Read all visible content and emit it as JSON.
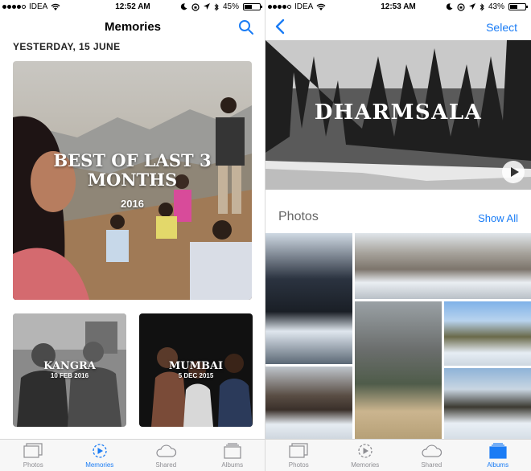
{
  "left_screen": {
    "status": {
      "carrier": "IDEA",
      "time": "12:52 AM",
      "battery": "45%",
      "battery_level": 0.45
    },
    "nav": {
      "title": "Memories"
    },
    "section_date": "YESTERDAY, 15 JUNE",
    "memories": [
      {
        "title_line1": "BEST OF LAST 3",
        "title_line2": "MONTHS",
        "subtitle": "2016"
      },
      {
        "title": "KANGRA",
        "subtitle": "10 FEB 2016"
      },
      {
        "title": "MUMBAI",
        "subtitle": "5 DEC 2015"
      }
    ],
    "tabs": [
      {
        "label": "Photos",
        "icon": "photos-icon"
      },
      {
        "label": "Memories",
        "icon": "memories-icon"
      },
      {
        "label": "Shared",
        "icon": "cloud-icon"
      },
      {
        "label": "Albums",
        "icon": "albums-icon"
      }
    ],
    "active_tab": "Memories"
  },
  "right_screen": {
    "status": {
      "carrier": "IDEA",
      "time": "12:53 AM",
      "battery": "43%",
      "battery_level": 0.43
    },
    "nav": {
      "select_label": "Select"
    },
    "hero_title": "DHARMSALA",
    "photos_heading": "Photos",
    "show_all_label": "Show All",
    "tabs": [
      {
        "label": "Photos",
        "icon": "photos-icon"
      },
      {
        "label": "Memories",
        "icon": "memories-icon"
      },
      {
        "label": "Shared",
        "icon": "cloud-icon"
      },
      {
        "label": "Albums",
        "icon": "albums-icon"
      }
    ],
    "active_tab": "Albums"
  },
  "colors": {
    "accent": "#1a7cf5",
    "inactive_tab": "#8e8e93"
  }
}
